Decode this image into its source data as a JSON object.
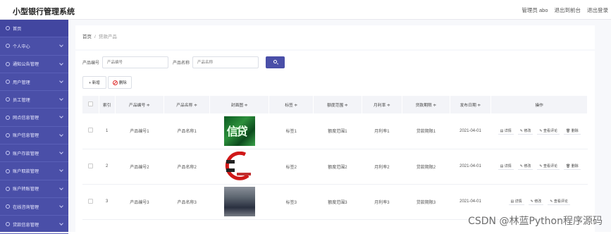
{
  "app": {
    "title": "小型银行管理系统"
  },
  "top_links": {
    "admin": "管理员 abo",
    "frontend": "退出到前台",
    "logout": "退出登录"
  },
  "sidebar": {
    "items": [
      {
        "label": "首页"
      },
      {
        "label": "个人中心"
      },
      {
        "label": "通知公告管理"
      },
      {
        "label": "用户管理"
      },
      {
        "label": "员工管理"
      },
      {
        "label": "网点信息管理"
      },
      {
        "label": "账户信息管理"
      },
      {
        "label": "账户存款管理"
      },
      {
        "label": "账户取款管理"
      },
      {
        "label": "账户转账管理"
      },
      {
        "label": "在线咨询管理"
      },
      {
        "label": "贷款信息管理"
      }
    ]
  },
  "breadcrumb": {
    "home": "首页",
    "sep": "/",
    "current": "贷款产品"
  },
  "search": {
    "code_label": "产品编号",
    "code_placeholder": "产品编号",
    "name_label": "产品名称",
    "name_placeholder": "产品名称"
  },
  "toolbar": {
    "add_label": "+ 新增",
    "delete_label": "删除"
  },
  "table": {
    "headers": [
      "索引",
      "产品编号 ≑",
      "产品名称 ≑",
      "封面图 ≑",
      "标签 ≑",
      "额度范围 ≑",
      "月利率 ≑",
      "贷款期限 ≑",
      "发布日期 ≑",
      "操作"
    ],
    "rows": [
      {
        "index": "1",
        "code": "产品编号1",
        "name": "产品名称1",
        "tag": "标签1",
        "range": "额度范围1",
        "rate": "月利率1",
        "term": "贷款期限1",
        "date": "2021-04-01"
      },
      {
        "index": "2",
        "code": "产品编号2",
        "name": "产品名称2",
        "tag": "标签2",
        "range": "额度范围2",
        "rate": "月利率2",
        "term": "贷款期限2",
        "date": "2021-04-01"
      },
      {
        "index": "3",
        "code": "产品编号3",
        "name": "产品名称3",
        "tag": "标签3",
        "range": "额度范围3",
        "rate": "月利率3",
        "term": "贷款期限3",
        "date": "2021-04-01"
      }
    ],
    "ops": {
      "detail": "详情",
      "edit": "修改",
      "review": "查看评论",
      "delete": "删除"
    },
    "img1_text": "信贷"
  },
  "watermark": "CSDN @林蓝Python程序源码"
}
